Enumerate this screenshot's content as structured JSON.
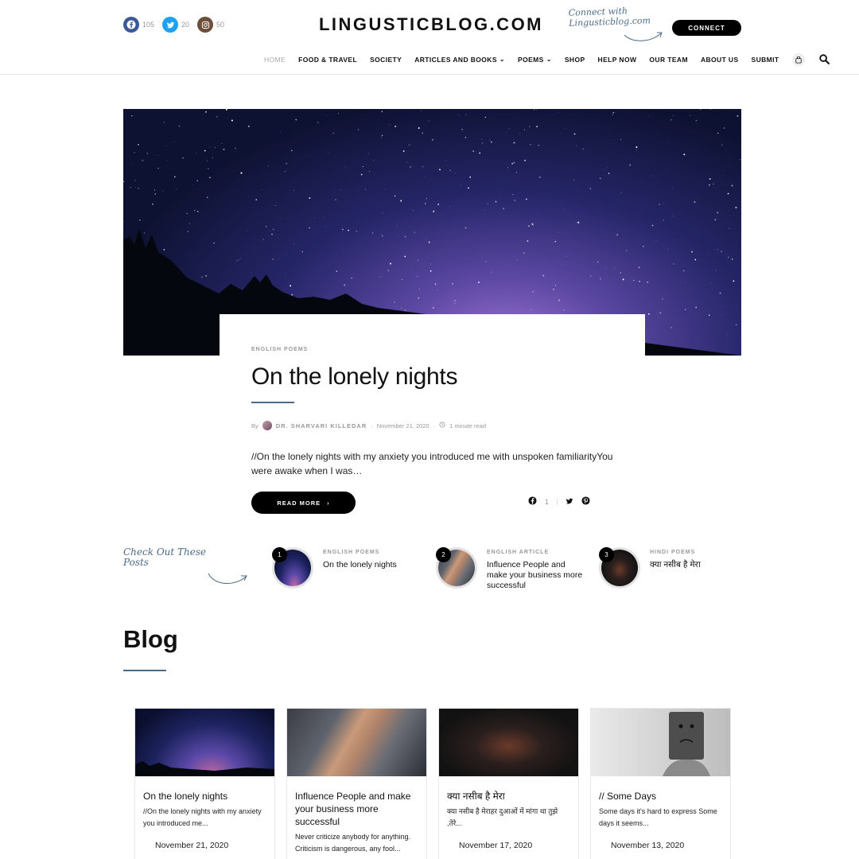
{
  "header": {
    "logo": "LINGUSTICBLOG.COM",
    "social": [
      {
        "icon": "facebook-icon",
        "count": "105",
        "color": "#3b5998"
      },
      {
        "icon": "twitter-icon",
        "count": "20",
        "color": "#1da1f2"
      },
      {
        "icon": "instagram-icon",
        "count": "50",
        "color": "#6b4f3a"
      }
    ],
    "connect_note_line1": "Connect with",
    "connect_note_line2": "Lingusticblog.com",
    "connect_button": "CONNECT"
  },
  "nav": {
    "items": [
      {
        "label": "HOME",
        "active": true
      },
      {
        "label": "FOOD & TRAVEL"
      },
      {
        "label": "SOCIETY"
      },
      {
        "label": "ARTICLES AND BOOKS",
        "dropdown": true
      },
      {
        "label": "POEMS",
        "dropdown": true
      },
      {
        "label": "SHOP"
      },
      {
        "label": "HELP NOW"
      },
      {
        "label": "OUR TEAM"
      },
      {
        "label": "ABOUT US"
      },
      {
        "label": "SUBMIT"
      }
    ]
  },
  "hero": {
    "category": "ENGLISH POEMS",
    "title": "On the lonely nights",
    "by": "By",
    "author": "DR. SHARVARI KILLEDAR",
    "date": "November 21, 2020",
    "read_time": "1 minute read",
    "excerpt": "//On the lonely nights with my anxiety you introduced me with unspoken familiarityYou were awake when I was…",
    "read_more": "READ MORE",
    "facebook_shares": "1"
  },
  "featured": {
    "note_line1": "Check Out These",
    "note_line2": "Posts",
    "items": [
      {
        "num": "1",
        "category": "ENGLISH POEMS",
        "title": "On the lonely nights"
      },
      {
        "num": "2",
        "category": "ENGLISH ARTICLE",
        "title": "Influence People and make your business more successful"
      },
      {
        "num": "3",
        "category": "HINDI POEMS",
        "title": "क्या नसीब है मेरा"
      }
    ]
  },
  "blog": {
    "heading": "Blog",
    "cards": [
      {
        "title": "On the lonely nights",
        "excerpt": "//On the lonely nights with my anxiety you introduced me...",
        "date": "November 21, 2020"
      },
      {
        "title": "Influence People and make your business more successful",
        "excerpt": "Never criticize anybody for anything. Criticism is dangerous, any fool...",
        "date": ""
      },
      {
        "title": "क्या नसीब है मेरा",
        "excerpt": "क्या नसीब है मेराहर दुआओं में मांगा था तुझे ,तेरे...",
        "date": "November 17, 2020"
      },
      {
        "title": "// Some Days",
        "excerpt": "Some days it's hard to express Some days it seems...",
        "date": "November 13, 2020"
      }
    ]
  }
}
